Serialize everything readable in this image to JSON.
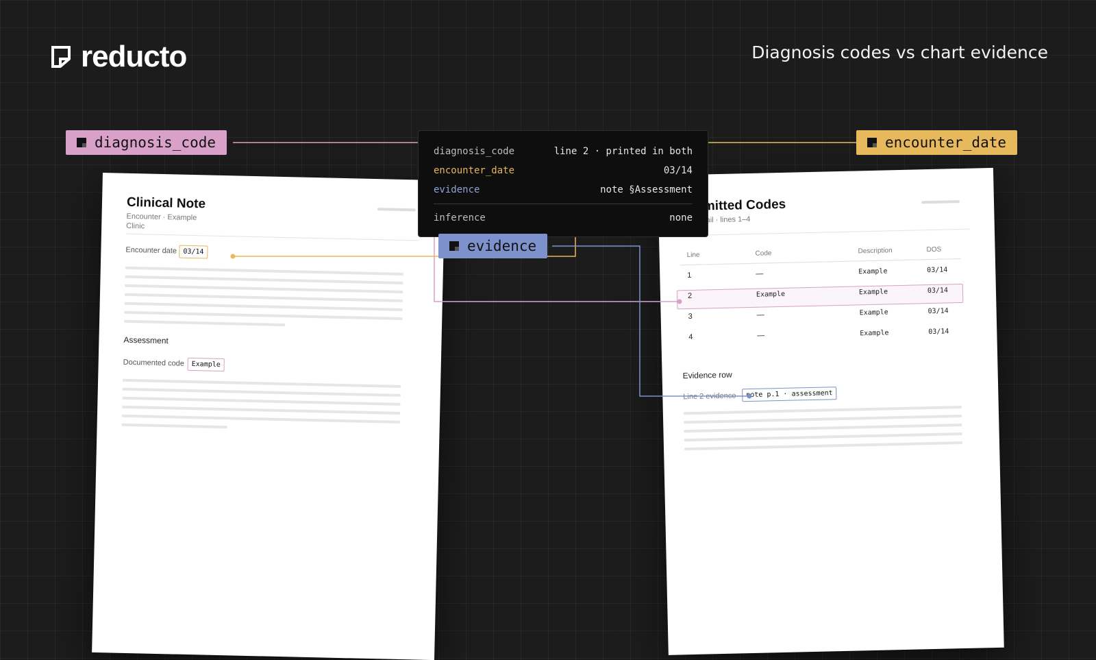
{
  "header": {
    "brand": "reducto",
    "title": "Diagnosis codes vs chart evidence"
  },
  "tags": {
    "diagnosis_code": "diagnosis_code",
    "encounter_date": "encounter_date",
    "evidence": "evidence"
  },
  "colors": {
    "diagnosis_code": "#d9a1c9",
    "encounter_date": "#e8b95c",
    "evidence": "#7d92cc"
  },
  "panel": {
    "rows": [
      {
        "key": "diagnosis_code",
        "value": "line 2 · printed in both"
      },
      {
        "key": "encounter_date",
        "value": "03/14"
      },
      {
        "key": "evidence",
        "value": "note §Assessment"
      }
    ],
    "footer": {
      "key": "inference",
      "value": "none"
    }
  },
  "left_doc": {
    "title": "Clinical Note",
    "subtitle": "Encounter · Example Clinic",
    "encounter_label": "Encounter date",
    "encounter_value": "03/14",
    "section": "Assessment",
    "code_label": "Documented code",
    "code_value": "Example"
  },
  "right_doc": {
    "title": "Submitted Codes",
    "subtitle": "Line detail · lines 1–4",
    "columns": [
      "Line",
      "Code",
      "Description",
      "DOS"
    ],
    "rows": [
      [
        "1",
        "—",
        "Example",
        "03/14"
      ],
      [
        "2",
        "Example",
        "Example",
        "03/14"
      ],
      [
        "3",
        "—",
        "Example",
        "03/14"
      ],
      [
        "4",
        "—",
        "Example",
        "03/14"
      ]
    ],
    "evidence_section": "Evidence row",
    "evidence_label": "Line 2 evidence",
    "evidence_value": "note p.1 · assessment"
  }
}
